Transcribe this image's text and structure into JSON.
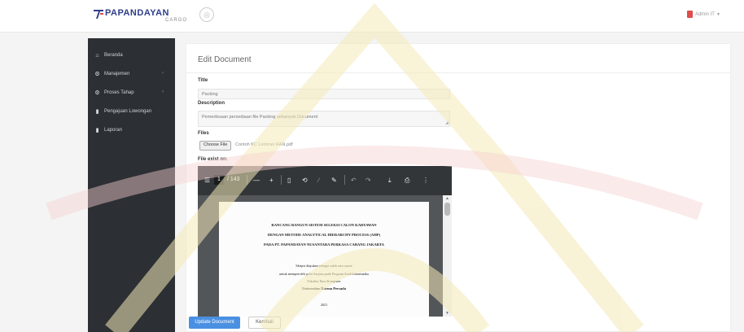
{
  "brand": {
    "name": "PAPANDAYAN",
    "sub": "CARGO",
    "color": "#2e3e8c",
    "accent": "#e04c4c"
  },
  "header": {
    "toggle_icon": "circle-arrow-icon",
    "user_label": "Admin IT"
  },
  "sidebar": {
    "items": [
      {
        "label": "Beranda",
        "icon": "home-icon"
      },
      {
        "label": "Manajemen",
        "icon": "gears-icon",
        "chevron": "‹"
      },
      {
        "label": "Proses Tahap",
        "icon": "gear-icon",
        "chevron": "‹"
      },
      {
        "label": "Pengajuan Lowongan",
        "icon": "book-icon"
      },
      {
        "label": "Laporan",
        "icon": "file-icon"
      }
    ]
  },
  "form": {
    "title": "Edit Document",
    "title_label": "Title",
    "title_value": "Packing",
    "description_label": "Description",
    "description_value": "Pemeriksaan persediaan file Packing sebanyak Document",
    "files_label": "Files",
    "choose_file": "Choose File",
    "file_name": "Contoh KC Lemiran RAN.pdf",
    "file_exist_label": "File exist on:"
  },
  "pdf": {
    "page": "1",
    "total": "/ 143",
    "zoom_minus": "—",
    "zoom_plus": "+",
    "lines": [
      {
        "text": "RANCANG BANGUN SISTEM SELEKSI CALON KARYAWAN",
        "style": "bold"
      },
      {
        "text": "DENGAN METODE ANALYTICAL HIERARCHY PROCESS (AHP)",
        "style": "bold"
      },
      {
        "text": "PADA PT. PAPANDAYAN NUSANTARA PERKASA CABANG JAKARTA",
        "style": "bold"
      },
      {
        "text": "Skripsi diajukan sebagai salah satu syarat",
        "style": "norm"
      },
      {
        "text": "untuk memperoleh gelar Sarjana pada Program Studi Informatika",
        "style": "norm"
      },
      {
        "text": "Fakultas Ilmu Komputer",
        "style": "norm"
      },
      {
        "text": "Universitas Darma Persada",
        "style": "norm"
      },
      {
        "text": "2021",
        "style": "norm"
      }
    ]
  },
  "actions": {
    "submit": "Update Document",
    "back": "Kembali"
  }
}
